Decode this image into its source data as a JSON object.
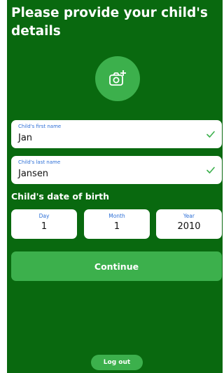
{
  "header": {
    "title": "Please provide your child's details"
  },
  "photo": {
    "icon": "add-photo-camera-icon"
  },
  "first_name": {
    "label": "Child's first name",
    "value": "Jan",
    "status_icon": "check-icon"
  },
  "last_name": {
    "label": "Child's last name",
    "value": "Jansen",
    "status_icon": "check-icon"
  },
  "dob": {
    "section_label": "Child's date of birth",
    "day": {
      "label": "Day",
      "value": "1"
    },
    "month": {
      "label": "Month",
      "value": "1"
    },
    "year": {
      "label": "Year",
      "value": "2010"
    }
  },
  "actions": {
    "continue_label": "Continue",
    "logout_label": "Log out"
  },
  "colors": {
    "background": "#09690f",
    "accent": "#3cb04c",
    "field_label": "#2d6fd6",
    "check": "#3cb04c"
  }
}
